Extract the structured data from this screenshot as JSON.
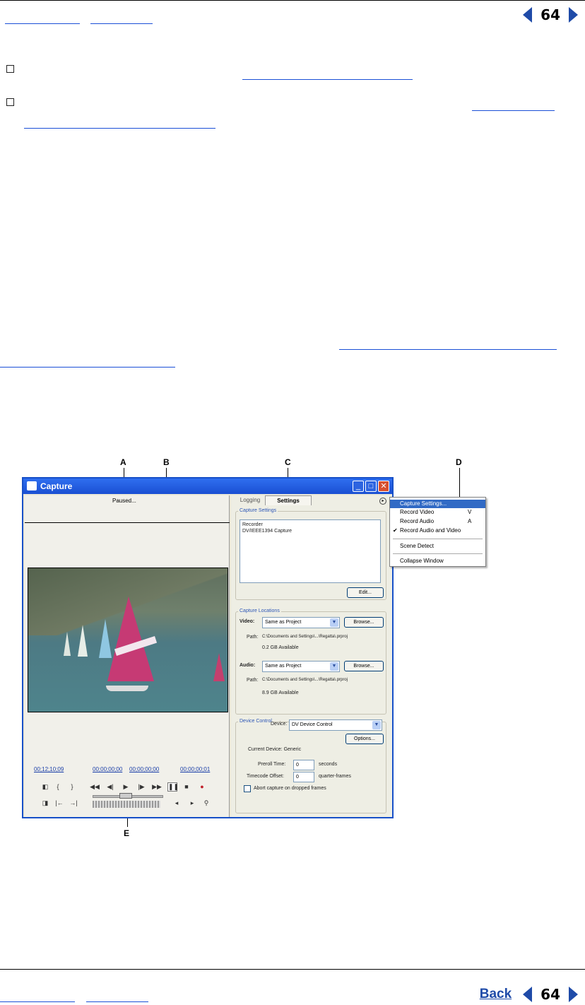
{
  "page": {
    "number": "64",
    "back_label": "Back"
  },
  "capture_window": {
    "title": "Capture",
    "status": "Paused...",
    "tabs": [
      "Logging",
      "Settings"
    ],
    "timecodes": {
      "current": "00;12;10;09",
      "in": "00;00;00;00",
      "out": "00;00;00;00",
      "duration": "00;00;00;01"
    },
    "settings": {
      "capture_settings_label": "Capture Settings",
      "capture_settings_text_line1": "Recorder",
      "capture_settings_text_line2": "DV/IEEE1394 Capture",
      "edit_button": "Edit...",
      "capture_locations_label": "Capture Locations",
      "video_label": "Video:",
      "video_value": "Same as Project",
      "video_path_label": "Path:",
      "video_path": "C:\\Documents and Settings\\...\\Regatta\\.prproj",
      "video_available": "0.2 GB Available",
      "audio_label": "Audio:",
      "audio_value": "Same as Project",
      "audio_path_label": "Path:",
      "audio_path": "C:\\Documents and Settings\\...\\Regatta\\.prproj",
      "audio_available": "8.9 GB Available",
      "browse_button": "Browse...",
      "device_control_label": "Device Control",
      "device_label": "Device:",
      "device_value": "DV Device Control",
      "options_button": "Options...",
      "current_device": "Current Device: Generic",
      "preroll_label": "Preroll Time:",
      "preroll_value": "0",
      "preroll_unit": "seconds",
      "tc_offset_label": "Timecode Offset:",
      "tc_offset_value": "0",
      "tc_offset_unit": "quarter-frames",
      "abort_label": "Abort capture on dropped frames"
    }
  },
  "panel_menu": {
    "items": [
      {
        "label": "Capture Settings...",
        "shortcut": "",
        "selected": true
      },
      {
        "label": "Record Video",
        "shortcut": "V",
        "selected": false
      },
      {
        "label": "Record Audio",
        "shortcut": "A",
        "selected": false
      },
      {
        "label": "Record Audio and Video",
        "shortcut": "",
        "checked": true
      },
      {
        "label": "Scene Detect",
        "shortcut": ""
      },
      {
        "label": "Collapse Window",
        "shortcut": ""
      }
    ]
  },
  "callouts": [
    "A",
    "B",
    "C",
    "D",
    "E"
  ],
  "colors": {
    "link": "#1a4fd6",
    "nav_arrow": "#1f4ba8",
    "titlebar": "#2f6ff0",
    "menu_highlight": "#316ac5"
  }
}
